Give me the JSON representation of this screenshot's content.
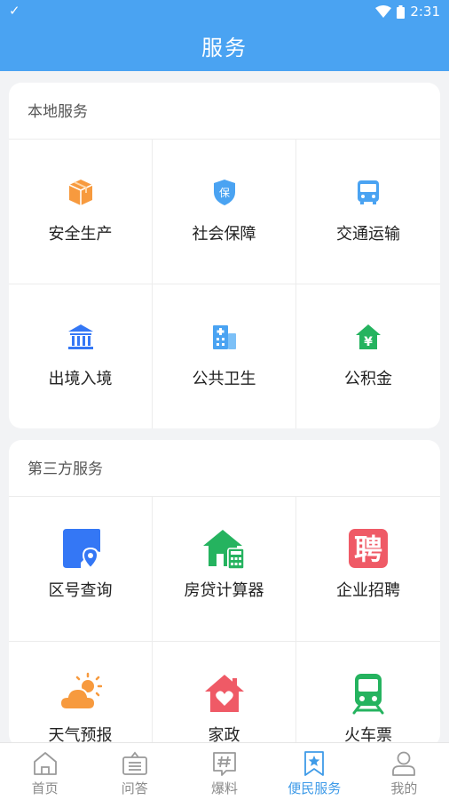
{
  "status_bar": {
    "time": "2:31"
  },
  "header": {
    "title": "服务"
  },
  "local_services": {
    "title": "本地服务",
    "items": [
      {
        "label": "安全生产",
        "icon": "package-icon"
      },
      {
        "label": "社会保障",
        "icon": "shield-icon"
      },
      {
        "label": "交通运输",
        "icon": "bus-icon"
      },
      {
        "label": "出境入境",
        "icon": "bank-building-icon"
      },
      {
        "label": "公共卫生",
        "icon": "hospital-icon"
      },
      {
        "label": "公积金",
        "icon": "house-yuan-icon"
      }
    ]
  },
  "third_party_services": {
    "title": "第三方服务",
    "items": [
      {
        "label": "区号查询",
        "icon": "map-pin-icon"
      },
      {
        "label": "房贷计算器",
        "icon": "house-calculator-icon"
      },
      {
        "label": "企业招聘",
        "icon": "recruit-icon",
        "icon_text": "聘"
      },
      {
        "label": "天气预报",
        "icon": "weather-icon"
      },
      {
        "label": "家政",
        "icon": "home-heart-icon"
      },
      {
        "label": "火车票",
        "icon": "train-icon"
      }
    ]
  },
  "tabbar": {
    "tabs": [
      {
        "label": "首页",
        "icon": "home-icon"
      },
      {
        "label": "问答",
        "icon": "qa-icon"
      },
      {
        "label": "爆料",
        "icon": "hashtag-icon"
      },
      {
        "label": "便民服务",
        "icon": "bookmark-star-icon",
        "active": true
      },
      {
        "label": "我的",
        "icon": "user-icon"
      }
    ]
  },
  "colors": {
    "accent": "#4aa3f2",
    "tab_active": "#3f9be8",
    "orange": "#f79a3e",
    "green": "#25b35f",
    "red": "#ef5a66",
    "blue": "#3477f5"
  }
}
